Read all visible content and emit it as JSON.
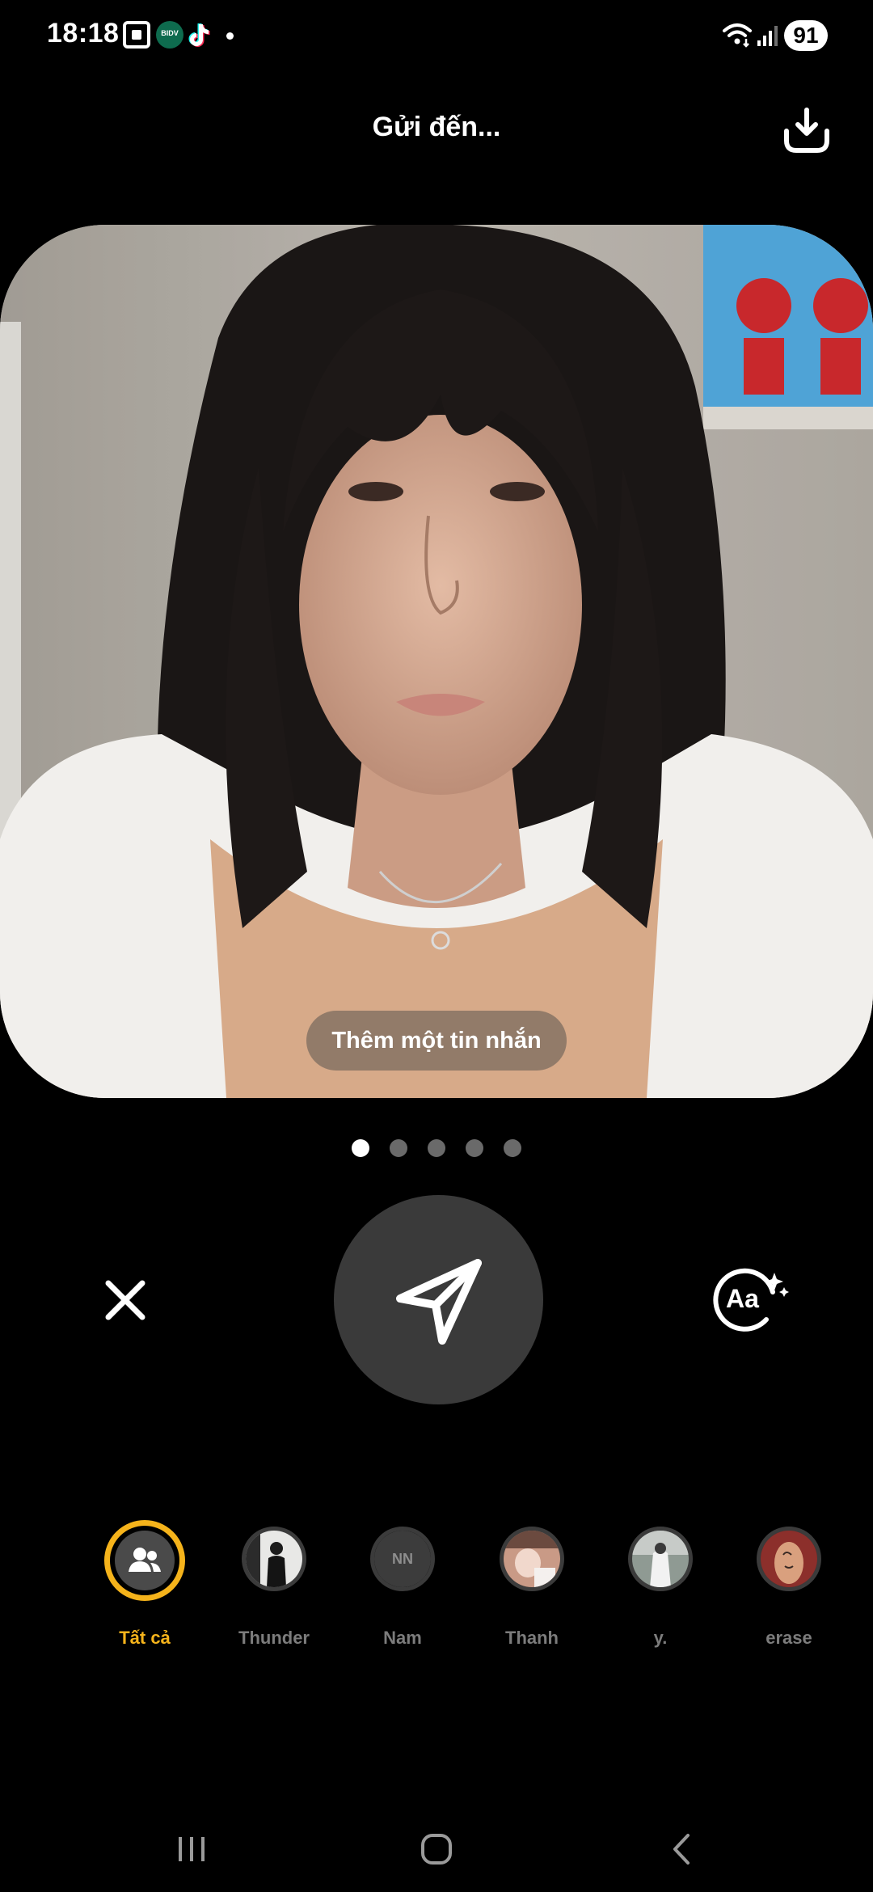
{
  "status_bar": {
    "time": "18:18",
    "bidv_label": "BIDV",
    "battery_level": "91",
    "icons": [
      "screenshot-icon",
      "bidv-app-icon",
      "tiktok-icon",
      "notification-dot",
      "wifi-icon",
      "signal-icon",
      "battery-icon"
    ]
  },
  "header": {
    "title": "Gửi đến...",
    "download_icon": "download-icon"
  },
  "photo": {
    "message_placeholder": "Thêm một tin nhắn"
  },
  "pager": {
    "count": 5,
    "active_index": 0
  },
  "controls": {
    "close_icon": "close-icon",
    "send_icon": "send-icon",
    "text_style_icon": "text-effects-icon",
    "text_style_label": "Aa"
  },
  "recipients": {
    "items": [
      {
        "name": "Tất cả",
        "active": true,
        "avatar": "group-icon"
      },
      {
        "name": "Thunder",
        "active": false,
        "avatar": "photo"
      },
      {
        "name": "Nam",
        "active": false,
        "avatar": "initials",
        "initials": "NN"
      },
      {
        "name": "Thanh",
        "active": false,
        "avatar": "photo"
      },
      {
        "name": "y.",
        "active": false,
        "avatar": "photo"
      },
      {
        "name": "erase",
        "active": false,
        "avatar": "photo"
      }
    ]
  },
  "nav": {
    "recents_icon": "recents-icon",
    "home_icon": "home-icon",
    "back_icon": "back-icon"
  },
  "colors": {
    "background": "#000000",
    "accent": "#f5b31b",
    "send_button": "#3a3a3a",
    "inactive_text": "#7c7c7c"
  }
}
